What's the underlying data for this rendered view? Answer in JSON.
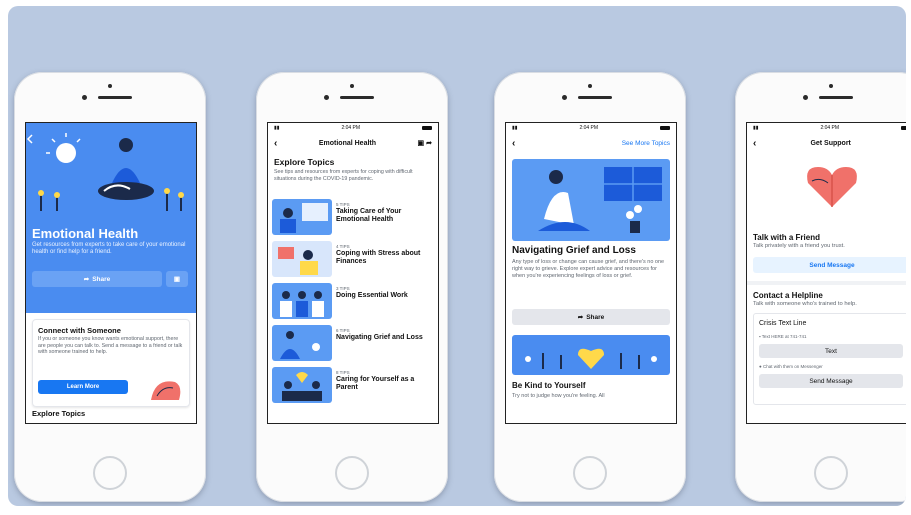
{
  "status_time": "2:04 PM",
  "phone1": {
    "title": "Emotional Health",
    "description": "Get resources from experts to take care of your emotional health or find help for a friend.",
    "share_label": "Share",
    "connect_title": "Connect with Someone",
    "connect_text": "If you or someone you know wants emotional support, there are people you can talk to. Send a message to a friend or talk with someone trained to help.",
    "learn_more": "Learn More",
    "explore_label": "Explore Topics"
  },
  "phone2": {
    "nav_title": "Emotional Health",
    "explore_title": "Explore Topics",
    "explore_desc": "See tips and resources from experts for coping with difficult situations during the COVID-19 pandemic.",
    "topics": [
      {
        "count": "5 TIPS",
        "title": "Taking Care of Your Emotional Health"
      },
      {
        "count": "4 TIPS",
        "title": "Coping with Stress about Finances"
      },
      {
        "count": "3 TIPS",
        "title": "Doing Essential Work"
      },
      {
        "count": "6 TIPS",
        "title": "Navigating Grief and Loss"
      },
      {
        "count": "8 TIPS",
        "title": "Caring for Yourself as a Parent"
      }
    ]
  },
  "phone3": {
    "see_more": "See More Topics",
    "title": "Navigating Grief and Loss",
    "description": "Any type of loss or change can cause grief, and there's no one right way to grieve. Explore expert advice and resources for when you're experiencing feelings of loss or grief.",
    "share_label": "Share",
    "card_title": "Be Kind to Yourself",
    "card_text": "Try not to judge how you're feeling. All"
  },
  "phone4": {
    "nav_title": "Get Support",
    "friend_title": "Talk with a Friend",
    "friend_text": "Talk privately with a friend you trust.",
    "send_message": "Send Message",
    "helpline_title": "Contact a Helpline",
    "helpline_text": "Talk with someone who's trained to help.",
    "crisis_title": "Crisis Text Line",
    "text_info": "Text HERE at 741-741",
    "text_button": "Text",
    "messenger_info": "Chat with them on Messenger",
    "send_message_2": "Send Message"
  },
  "colors": {
    "accent": "#1877f2",
    "hero_blue": "#4a8cf0",
    "backdrop": "#b9c9e1"
  }
}
